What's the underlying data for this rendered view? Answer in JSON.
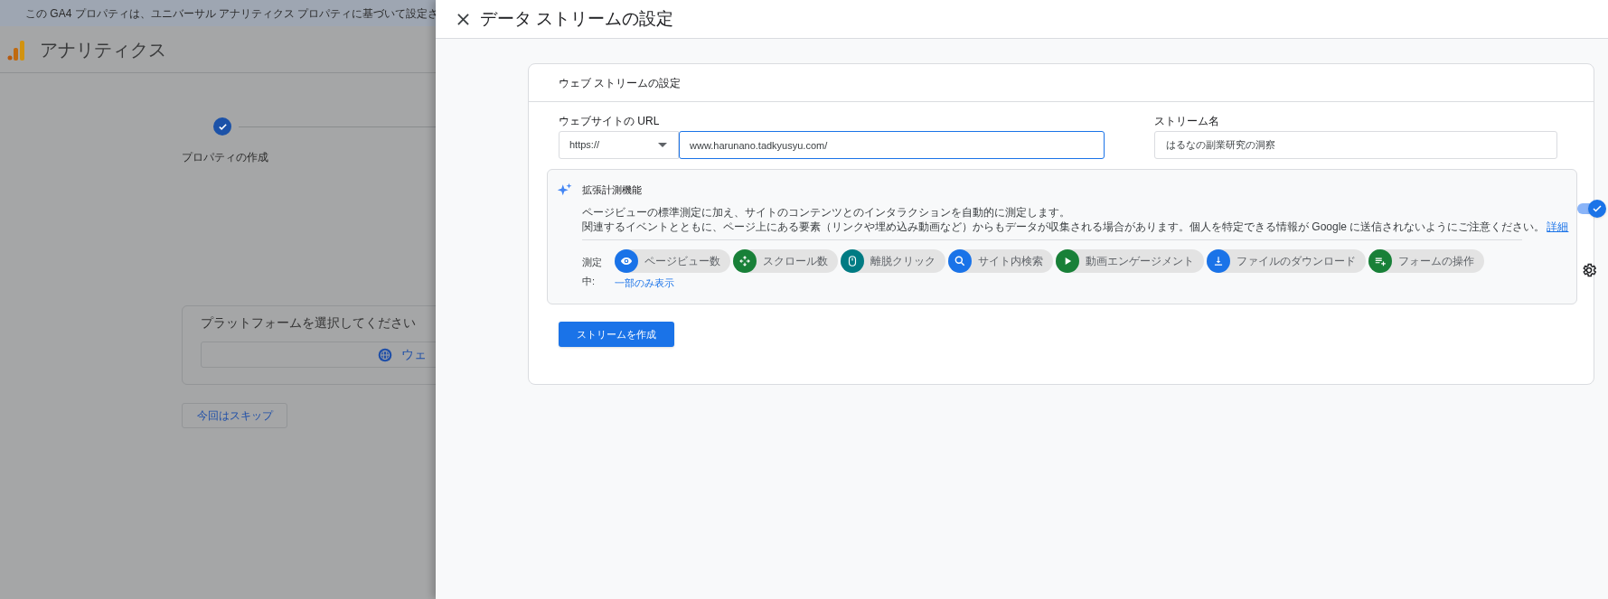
{
  "background": {
    "banner": "この GA4 プロパティは、ユニバーサル アナリティクス プロパティに基づいて設定さ",
    "app_title": "アナリティクス",
    "stepper": {
      "label": "プロパティの作成",
      "done": true
    },
    "platform_card": {
      "title": "プラットフォームを選択してください",
      "option": "ウェ"
    },
    "skip_button": "今回はスキップ"
  },
  "panel": {
    "title": "データ ストリームの設定",
    "card_title": "ウェブ ストリームの設定",
    "url_label": "ウェブサイトの URL",
    "protocol": "https://",
    "url": "www.harunano.tadkyusyu.com/",
    "stream_name_label": "ストリーム名",
    "stream_name": "はるなの副業研究の洞察",
    "enhanced": {
      "title": "拡張計測機能",
      "description_1": "ページビューの標準測定に加え、サイトのコンテンツとのインタラクションを自動的に測定します。",
      "description_2": "関連するイベントとともに、ページ上にある要素（リンクや埋め込み動画など）からもデータが収集される場合があります。個人を特定できる情報が Google に送信されないようにご注意ください。",
      "link": "詳細",
      "on": true,
      "measuring_label": "測定中:",
      "events": [
        {
          "kind": "eye",
          "label": "ページビュー数",
          "color": "#1a73e8"
        },
        {
          "kind": "scroll",
          "label": "スクロール数",
          "color": "#188038"
        },
        {
          "kind": "mouse",
          "label": "離脱クリック",
          "color": "#007b83"
        },
        {
          "kind": "search",
          "label": "サイト内検索",
          "color": "#1a73e8"
        },
        {
          "kind": "play",
          "label": "動画エンゲージメント",
          "color": "#188038"
        },
        {
          "kind": "download",
          "label": "ファイルのダウンロード",
          "color": "#1a73e8"
        },
        {
          "kind": "form",
          "label": "フォームの操作",
          "color": "#188038"
        }
      ],
      "show_less": "一部のみ表示"
    },
    "create_button": "ストリームを作成"
  }
}
